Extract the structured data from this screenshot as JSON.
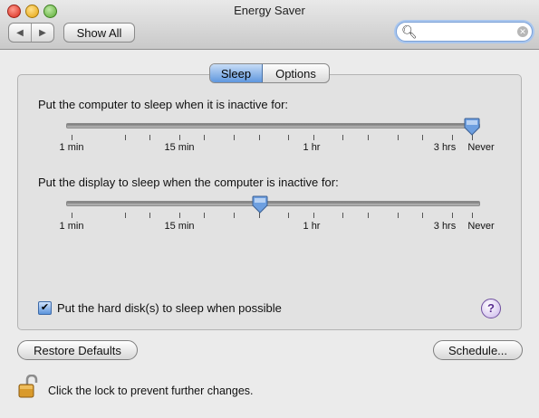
{
  "window": {
    "title": "Energy Saver"
  },
  "toolbar": {
    "show_all_label": "Show All",
    "back_glyph": "◀",
    "forward_glyph": "▶"
  },
  "search": {
    "value": "",
    "placeholder": ""
  },
  "tabs": [
    {
      "label": "Sleep",
      "selected": true
    },
    {
      "label": "Options",
      "selected": false
    }
  ],
  "computer_sleep": {
    "label": "Put the computer to sleep when it is inactive for:",
    "value": "Never",
    "position_fraction": 1.0
  },
  "display_sleep": {
    "label": "Put the display to sleep when the computer is inactive for:",
    "value": "1 hr",
    "position_fraction": 0.47
  },
  "tick_labels": [
    "1 min",
    "15 min",
    "1 hr",
    "3 hrs",
    "Never"
  ],
  "hard_disk": {
    "label": "Put the hard disk(s) to sleep when possible",
    "checked": true
  },
  "help": {
    "glyph": "?"
  },
  "buttons": {
    "restore_defaults": "Restore Defaults",
    "schedule": "Schedule..."
  },
  "lock": {
    "text": "Click the lock to prevent further changes.",
    "icon": "lock-icon"
  },
  "colors": {
    "accent": "#5f97de",
    "help": "#5a2e91"
  }
}
